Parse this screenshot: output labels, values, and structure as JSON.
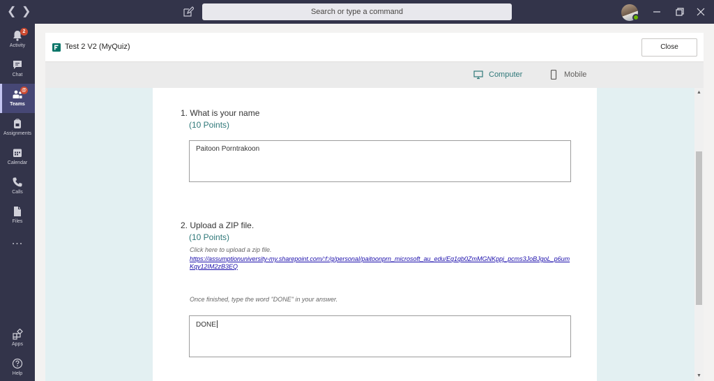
{
  "titlebar": {
    "search_placeholder": "Search or type a command",
    "back_icon": "chevron-left-icon",
    "forward_icon": "chevron-right-icon",
    "compose_icon": "compose-icon"
  },
  "rail": {
    "items": [
      {
        "label": "Activity",
        "icon": "bell-icon",
        "badge": "2"
      },
      {
        "label": "Chat",
        "icon": "chat-icon"
      },
      {
        "label": "Teams",
        "icon": "teams-icon",
        "badge": "@",
        "active": true
      },
      {
        "label": "Assignments",
        "icon": "backpack-icon"
      },
      {
        "label": "Calendar",
        "icon": "calendar-icon"
      },
      {
        "label": "Calls",
        "icon": "phone-icon"
      },
      {
        "label": "Files",
        "icon": "file-icon"
      }
    ],
    "more": "...",
    "bottom": [
      {
        "label": "Apps",
        "icon": "apps-icon"
      },
      {
        "label": "Help",
        "icon": "help-icon"
      }
    ]
  },
  "header": {
    "title": "Test 2 V2 (MyQuiz)",
    "close_label": "Close"
  },
  "view_toggle": {
    "computer": "Computer",
    "mobile": "Mobile",
    "selected": "Computer"
  },
  "questions": [
    {
      "title": "1. What is your name",
      "points": "(10 Points)",
      "answer": "Paitoon Porntrakoon"
    },
    {
      "title": "2. Upload a ZIP file.",
      "points": "(10 Points)",
      "instruction": "Click here to upload a zip file.",
      "link": "https://assumptionuniversity-my.sharepoint.com/:f:/g/personal/paitoonprn_microsoft_au_edu/Eq1qb0ZmMGNKppj_pcms3JoBJgoL_p6umKqy12IM2zB3EQ",
      "finish_note": "Once finished, type the word \"DONE\" in your answer.",
      "answer": "DONE"
    }
  ],
  "colors": {
    "rail_bg": "#33344a",
    "accent": "#6264a7",
    "points": "#2f7879",
    "badge": "#cc4a31",
    "preview_bg": "#e3f0f2"
  }
}
